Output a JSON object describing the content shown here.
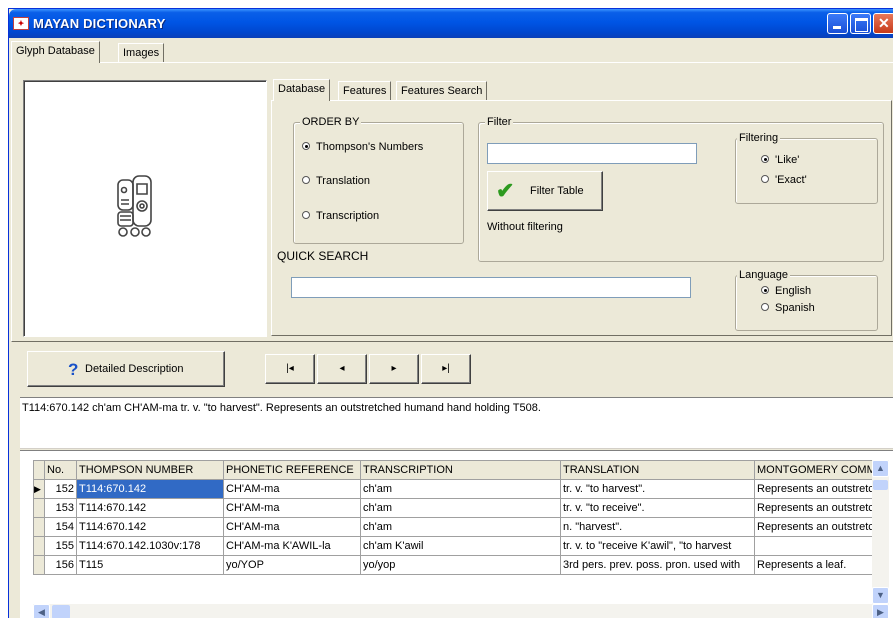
{
  "window": {
    "title": "MAYAN DICTIONARY"
  },
  "main_tabs": [
    {
      "label": "Glyph Database"
    },
    {
      "label": "Images"
    }
  ],
  "sub_tabs": [
    {
      "label": "Database"
    },
    {
      "label": "Features"
    },
    {
      "label": "Features Search"
    }
  ],
  "order_by": {
    "label": "ORDER BY",
    "options": [
      {
        "label": "Thompson's Numbers",
        "selected": true
      },
      {
        "label": "Translation",
        "selected": false
      },
      {
        "label": "Transcription",
        "selected": false
      }
    ]
  },
  "filter": {
    "label": "Filter",
    "input_value": "",
    "button_label": "Filter Table",
    "status": "Without filtering",
    "filtering": {
      "label": "Filtering",
      "options": [
        {
          "label": "'Like'",
          "selected": true
        },
        {
          "label": "'Exact'",
          "selected": false
        }
      ]
    }
  },
  "quick_search": {
    "label": "QUICK SEARCH",
    "value": ""
  },
  "language": {
    "label": "Language",
    "options": [
      {
        "label": "English",
        "selected": true
      },
      {
        "label": "Spanish",
        "selected": false
      }
    ]
  },
  "detail_button": {
    "label": "Detailed Description"
  },
  "nav": {
    "first": "|◂",
    "prev": "◂",
    "next": "▸",
    "last": "▸|"
  },
  "description": "T114:670.142  ch'am  CH'AM-ma  tr. v. \"to harvest\".  Represents an outstretched humand hand holding T508.",
  "table": {
    "columns": [
      "No.",
      "THOMPSON NUMBER",
      "PHONETIC REFERENCE",
      "TRANSCRIPTION",
      "TRANSLATION",
      "MONTGOMERY COMM"
    ],
    "rows": [
      [
        "152",
        "T114:670.142",
        "CH'AM-ma",
        "ch'am",
        "tr. v. \"to harvest\".",
        "Represents an outstretch"
      ],
      [
        "153",
        "T114:670.142",
        "CH'AM-ma",
        "ch'am",
        "tr. v. \"to receive\".",
        "Represents an outstretch"
      ],
      [
        "154",
        "T114:670.142",
        "CH'AM-ma",
        "ch'am",
        "n. \"harvest\".",
        "Represents an outstretch"
      ],
      [
        "155",
        "T114:670.142.1030v:178",
        "CH'AM-ma K'AWIL-la",
        "ch'am K'awil",
        "tr. v. to \"receive K'awil\", \"to harvest",
        ""
      ],
      [
        "156",
        "T115",
        "yo/YOP",
        "yo/yop",
        "3rd pers. prev. poss. pron. used with",
        "Represents a leaf."
      ]
    ],
    "selected_row": 0
  },
  "colors": {
    "titlebar": "#0055e5",
    "selection": "#316ac5",
    "face": "#ece9d8"
  }
}
